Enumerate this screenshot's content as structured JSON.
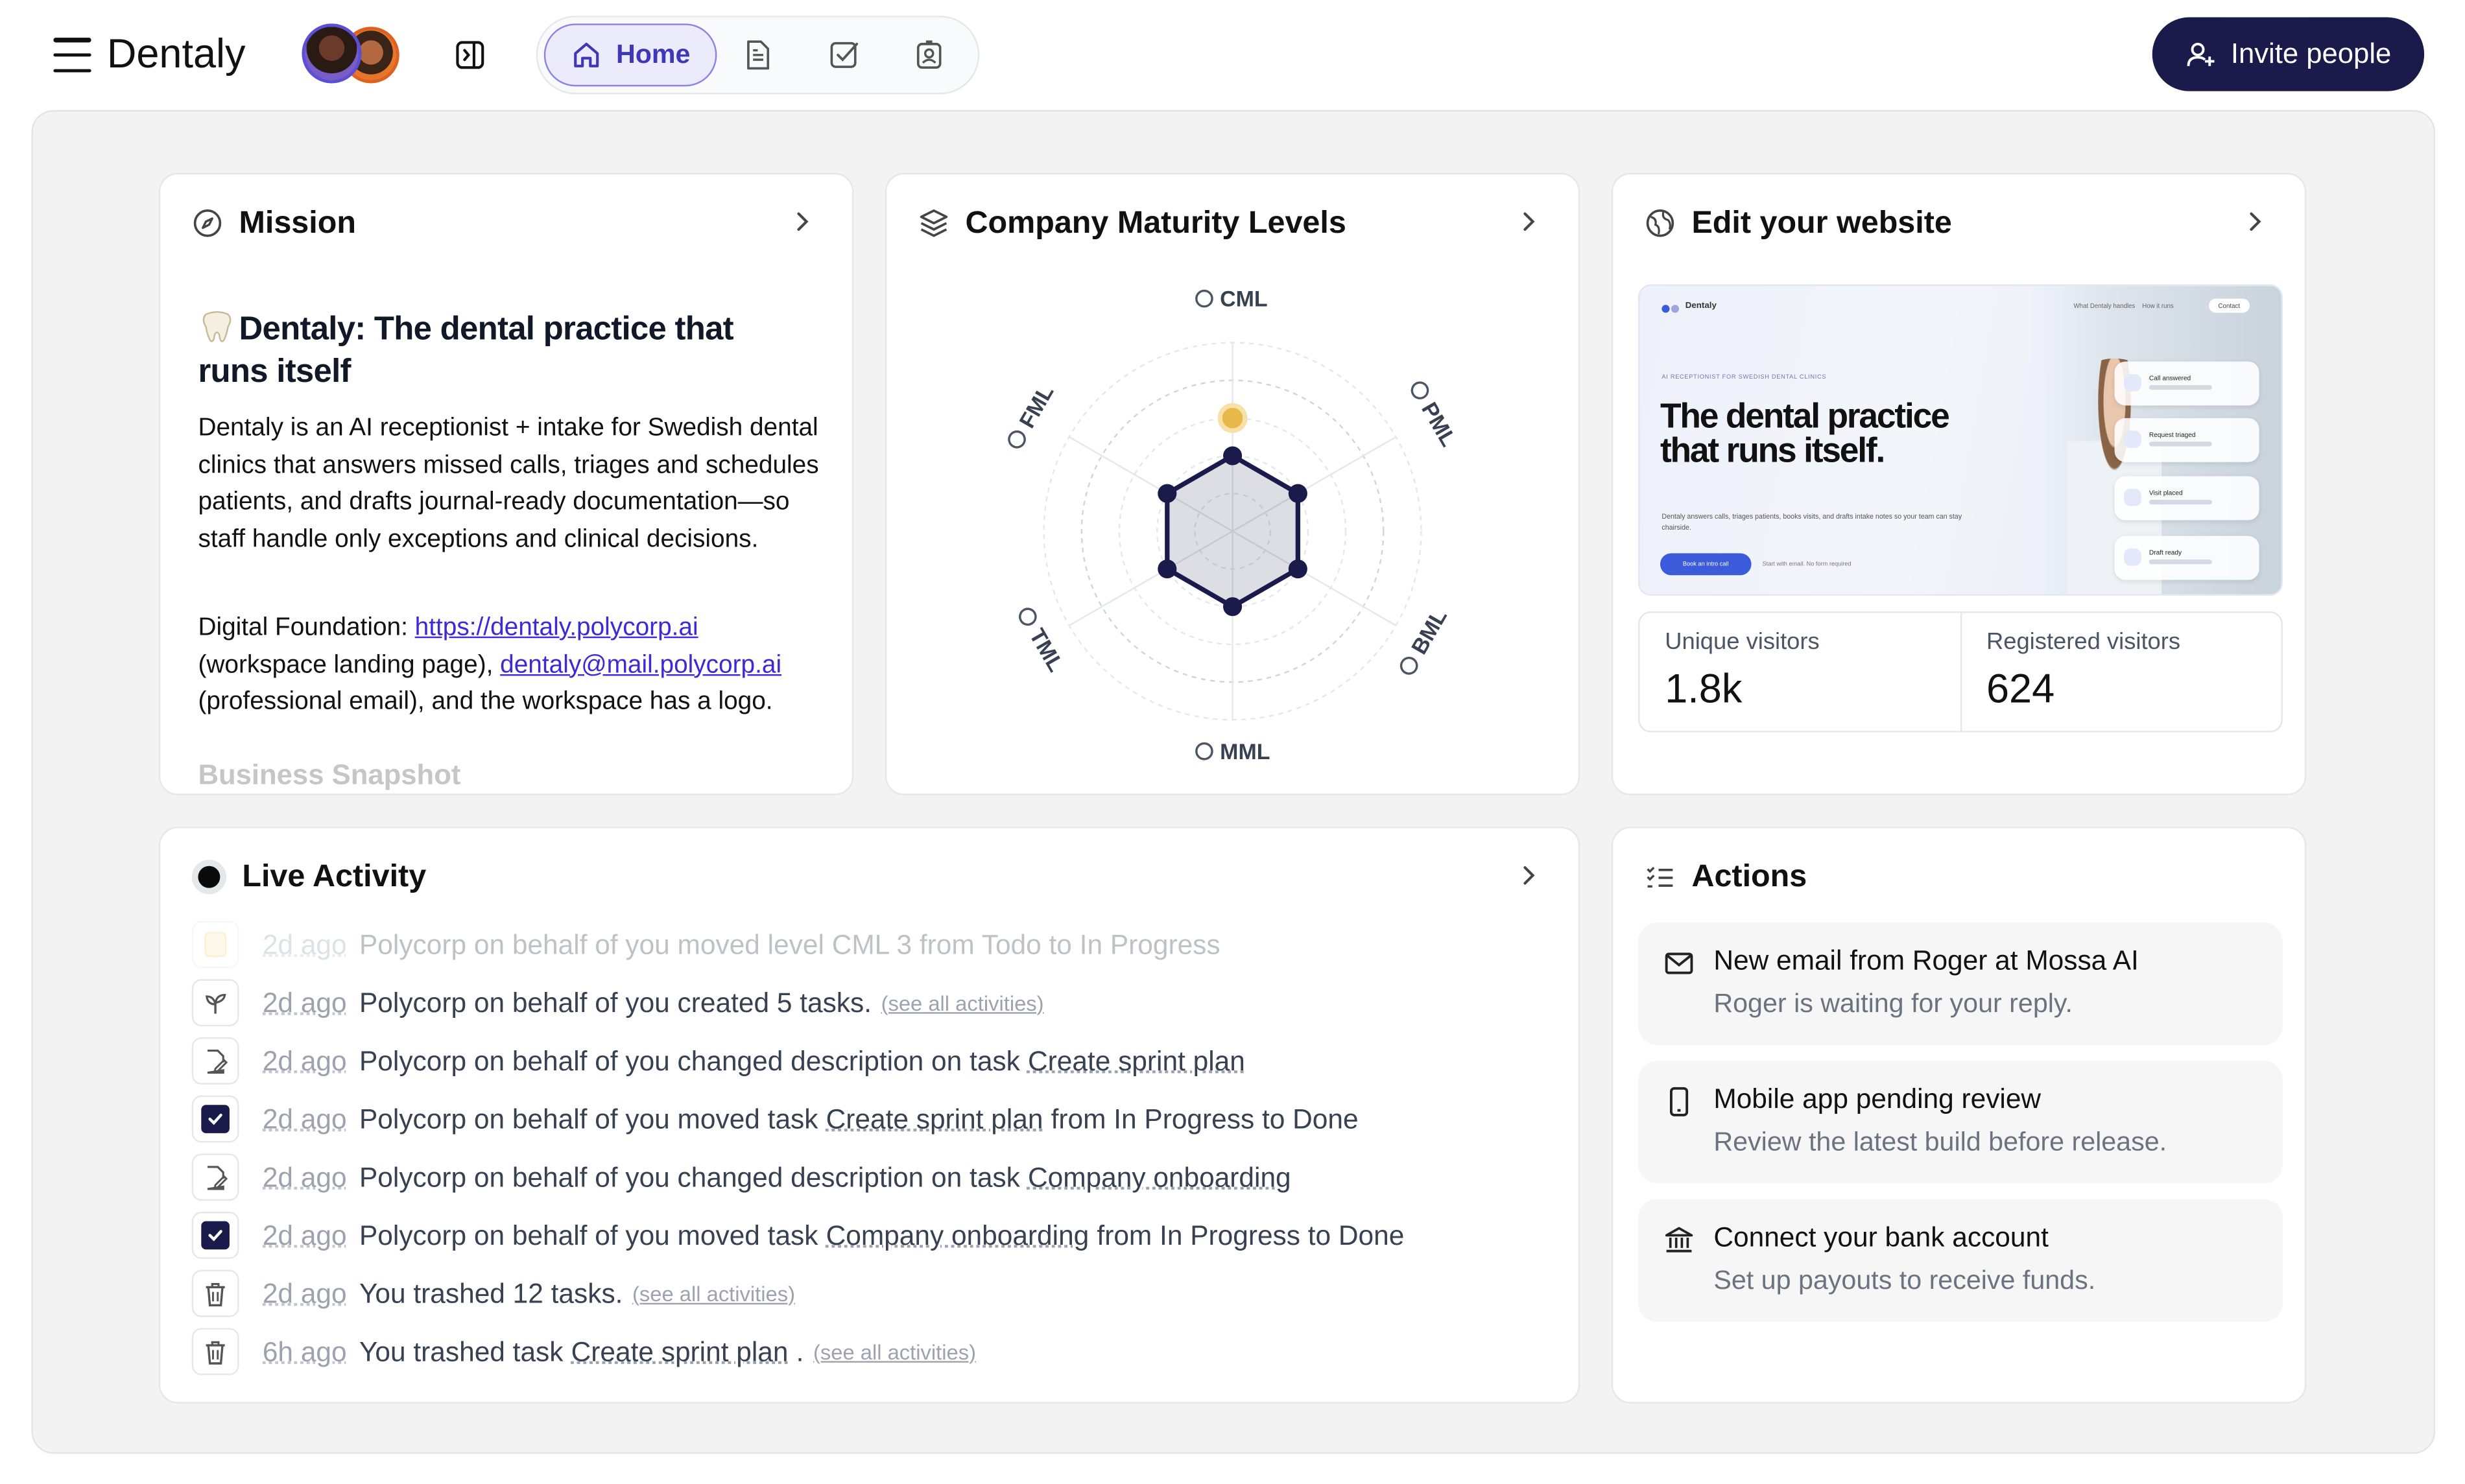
{
  "header": {
    "brand": "Dentaly",
    "nav_home_label": "Home",
    "invite_label": "Invite people"
  },
  "mission": {
    "title": "Mission",
    "headline": "Dentaly: The dental practice that runs itself",
    "body": "Dentaly is an AI receptionist + intake for Swedish dental clinics that answers missed calls, triages and schedules patients, and drafts journal-ready documentation—so staff handle only exceptions and clinical decisions.",
    "foundation_prefix": "Digital Foundation: ",
    "foundation_url": "https://dentaly.polycorp.ai",
    "foundation_mid": " (workspace landing page), ",
    "foundation_email": "dentaly@mail.polycorp.ai",
    "foundation_suffix": " (professional email), and the workspace has a logo.",
    "next_section": "Business Snapshot"
  },
  "maturity": {
    "title": "Company Maturity Levels",
    "axes": [
      "CML",
      "PML",
      "BML",
      "MML",
      "TML",
      "FML"
    ],
    "levels": [
      2,
      2,
      2,
      2,
      2,
      2
    ],
    "max_level": 5,
    "highlight_level_cml": 3,
    "accent": "#1a1b4b",
    "highlight_color": "#e8b84a"
  },
  "website": {
    "title": "Edit your website",
    "preview": {
      "brand": "Dentaly",
      "nav": [
        "What Dentaly handles",
        "How it runs",
        "Contact"
      ],
      "eyebrow": "AI RECEPTIONIST FOR SWEDISH DENTAL CLINICS",
      "headline": "The dental practice that runs itself.",
      "body": "Dentaly answers calls, triages patients, books visits, and drafts intake notes so your team can stay chairside.",
      "cta": "Book an intro call",
      "cta_note": "Start with email. No form required",
      "cards": [
        "Call answered",
        "Request triaged",
        "Visit placed",
        "Draft ready"
      ]
    },
    "stats": [
      {
        "label": "Unique visitors",
        "value": "1.8k"
      },
      {
        "label": "Registered visitors",
        "value": "624"
      }
    ]
  },
  "activity": {
    "title": "Live Activity",
    "items": [
      {
        "icon": "status",
        "time": "2d ago",
        "text": "Polycorp on behalf of you moved level CML 3 from Todo to In Progress",
        "link": "",
        "tail": "",
        "see": ""
      },
      {
        "icon": "sprout",
        "time": "2d ago",
        "text": "Polycorp on behalf of you created 5 tasks.",
        "link": "",
        "tail": "",
        "see": "(see all activities)"
      },
      {
        "icon": "edit",
        "time": "2d ago",
        "text": "Polycorp on behalf of you changed description on task",
        "link": "Create sprint plan",
        "tail": "",
        "see": ""
      },
      {
        "icon": "check",
        "time": "2d ago",
        "text": "Polycorp on behalf of you moved task",
        "link": "Create sprint plan",
        "tail": "from In Progress to Done",
        "see": ""
      },
      {
        "icon": "edit",
        "time": "2d ago",
        "text": "Polycorp on behalf of you changed description on task",
        "link": "Company onboarding",
        "tail": "",
        "see": ""
      },
      {
        "icon": "check",
        "time": "2d ago",
        "text": "Polycorp on behalf of you moved task",
        "link": "Company onboarding",
        "tail": "from In Progress to Done",
        "see": ""
      },
      {
        "icon": "trash",
        "time": "2d ago",
        "text": "You trashed 12 tasks.",
        "link": "",
        "tail": "",
        "see": "(see all activities)"
      },
      {
        "icon": "trash",
        "time": "6h ago",
        "text": "You trashed task",
        "link": "Create sprint plan",
        "tail": ".",
        "see": "(see all activities)"
      }
    ]
  },
  "actions": {
    "title": "Actions",
    "items": [
      {
        "icon": "mail-icon",
        "title": "New email from Roger at Mossa AI",
        "subtitle": "Roger is waiting for your reply."
      },
      {
        "icon": "phone-icon",
        "title": "Mobile app pending review",
        "subtitle": "Review the latest build before release."
      },
      {
        "icon": "bank-icon",
        "title": "Connect your bank account",
        "subtitle": "Set up payouts to receive funds."
      }
    ]
  }
}
